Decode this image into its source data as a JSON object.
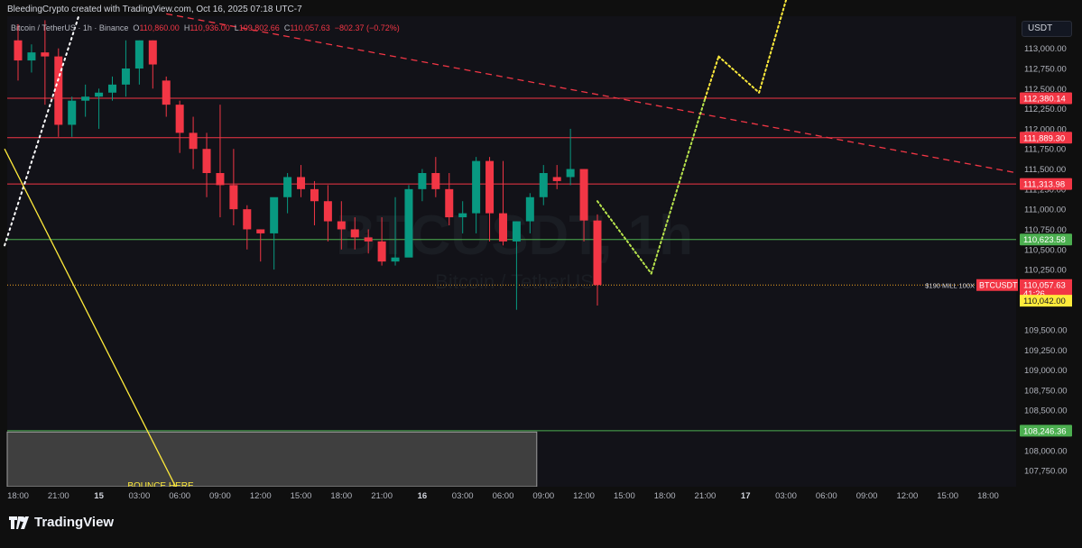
{
  "caption": "BleedingCrypto created with TradingView.com, Oct 16, 2025 07:18 UTC-7",
  "symbol_line": {
    "symbol": "Bitcoin / TetherUS · 1h · Binance",
    "o_label": "O",
    "o": "110,860.00",
    "h_label": "H",
    "h": "110,936.00",
    "l_label": "L",
    "l": "109,802.66",
    "c_label": "C",
    "c": "110,057.63",
    "change": "−802.37 (−0.72%)"
  },
  "currency_button": "USDT",
  "watermark": {
    "ticker": "BTCUSDT, 1h",
    "name": "Bitcoin / TetherUS"
  },
  "brand": "TradingView",
  "colors": {
    "background": "#0f0f0f",
    "up": "#089981",
    "down": "#f23645",
    "resistance_line": "#f23645",
    "support_line": "#4caf50",
    "current_price_line": "#f5a623",
    "target_yellow": "#ffeb3b"
  },
  "chart_data": {
    "type": "candlestick",
    "timeframe": "1h",
    "ylim": [
      107550,
      113400
    ],
    "y_ticks": [
      "113,000.00",
      "112,750.00",
      "112,500.00",
      "112,250.00",
      "112,000.00",
      "111,750.00",
      "111,500.00",
      "111,250.00",
      "111,000.00",
      "110,750.00",
      "110,500.00",
      "110,250.00",
      "109,500.00",
      "109,250.00",
      "109,000.00",
      "108,750.00",
      "108,500.00",
      "108,000.00",
      "107,750.00"
    ],
    "y_tick_values": [
      113000,
      112750,
      112500,
      112250,
      112000,
      111750,
      111500,
      111250,
      111000,
      110750,
      110500,
      110250,
      109500,
      109250,
      109000,
      108750,
      108500,
      108000,
      107750
    ],
    "x_ticks": [
      {
        "label": "18:00",
        "bar": 0
      },
      {
        "label": "21:00",
        "bar": 3
      },
      {
        "label": "15",
        "bar": 6,
        "bold": true
      },
      {
        "label": "03:00",
        "bar": 9
      },
      {
        "label": "06:00",
        "bar": 12
      },
      {
        "label": "09:00",
        "bar": 15
      },
      {
        "label": "12:00",
        "bar": 18
      },
      {
        "label": "15:00",
        "bar": 21
      },
      {
        "label": "18:00",
        "bar": 24
      },
      {
        "label": "21:00",
        "bar": 27
      },
      {
        "label": "16",
        "bar": 30,
        "bold": true
      },
      {
        "label": "03:00",
        "bar": 33
      },
      {
        "label": "06:00",
        "bar": 36
      },
      {
        "label": "09:00",
        "bar": 39
      },
      {
        "label": "12:00",
        "bar": 42
      },
      {
        "label": "15:00",
        "bar": 45
      },
      {
        "label": "18:00",
        "bar": 48
      },
      {
        "label": "21:00",
        "bar": 51
      },
      {
        "label": "17",
        "bar": 54,
        "bold": true
      },
      {
        "label": "03:00",
        "bar": 57
      },
      {
        "label": "06:00",
        "bar": 60
      },
      {
        "label": "09:00",
        "bar": 63
      },
      {
        "label": "12:00",
        "bar": 66
      },
      {
        "label": "15:00",
        "bar": 69
      },
      {
        "label": "18:00",
        "bar": 72
      }
    ],
    "candles": [
      {
        "o": 113100,
        "h": 113300,
        "c": 112850,
        "l": 112600
      },
      {
        "o": 112850,
        "h": 113050,
        "c": 112950,
        "l": 112700
      },
      {
        "o": 112950,
        "h": 113350,
        "c": 112900,
        "l": 112300
      },
      {
        "o": 112900,
        "h": 113000,
        "c": 112050,
        "l": 111900
      },
      {
        "o": 112050,
        "h": 112400,
        "c": 112350,
        "l": 111900
      },
      {
        "o": 112350,
        "h": 112550,
        "c": 112400,
        "l": 112150
      },
      {
        "o": 112400,
        "h": 112500,
        "c": 112450,
        "l": 112000
      },
      {
        "o": 112450,
        "h": 112650,
        "c": 112550,
        "l": 112350
      },
      {
        "o": 112550,
        "h": 113100,
        "c": 112750,
        "l": 112400
      },
      {
        "o": 112750,
        "h": 113100,
        "c": 113100,
        "l": 112550
      },
      {
        "o": 113100,
        "h": 113100,
        "c": 112800,
        "l": 112500
      },
      {
        "o": 112600,
        "h": 112650,
        "c": 112300,
        "l": 112150
      },
      {
        "o": 112300,
        "h": 112350,
        "c": 111950,
        "l": 111700
      },
      {
        "o": 111950,
        "h": 112150,
        "c": 111750,
        "l": 111500
      },
      {
        "o": 111750,
        "h": 111950,
        "c": 111450,
        "l": 111150
      },
      {
        "o": 111450,
        "h": 112300,
        "c": 111300,
        "l": 110900
      },
      {
        "o": 111300,
        "h": 111750,
        "c": 111000,
        "l": 110800
      },
      {
        "o": 111000,
        "h": 111050,
        "c": 110750,
        "l": 110500
      },
      {
        "o": 110750,
        "h": 110750,
        "c": 110700,
        "l": 110350
      },
      {
        "o": 110700,
        "h": 110800,
        "c": 111150,
        "l": 110250
      },
      {
        "o": 111150,
        "h": 111450,
        "c": 111400,
        "l": 110950
      },
      {
        "o": 111400,
        "h": 111550,
        "c": 111250,
        "l": 111150
      },
      {
        "o": 111250,
        "h": 111350,
        "c": 111100,
        "l": 110800
      },
      {
        "o": 111100,
        "h": 111300,
        "c": 110850,
        "l": 110600
      },
      {
        "o": 110850,
        "h": 111100,
        "c": 110750,
        "l": 110500
      },
      {
        "o": 110750,
        "h": 110900,
        "c": 110650,
        "l": 110500
      },
      {
        "o": 110650,
        "h": 110750,
        "c": 110600,
        "l": 110450
      },
      {
        "o": 110600,
        "h": 110900,
        "c": 110350,
        "l": 110300
      },
      {
        "o": 110350,
        "h": 111150,
        "c": 110400,
        "l": 110300
      },
      {
        "o": 110400,
        "h": 111300,
        "c": 111250,
        "l": 111050
      },
      {
        "o": 111250,
        "h": 111500,
        "c": 111450,
        "l": 111100
      },
      {
        "o": 111450,
        "h": 111650,
        "c": 111250,
        "l": 111150
      },
      {
        "o": 111250,
        "h": 111450,
        "c": 110900,
        "l": 110800
      },
      {
        "o": 110900,
        "h": 111100,
        "c": 110950,
        "l": 110700
      },
      {
        "o": 110950,
        "h": 111650,
        "c": 111600,
        "l": 110700
      },
      {
        "o": 111600,
        "h": 111650,
        "c": 110950,
        "l": 110600
      },
      {
        "o": 110950,
        "h": 111600,
        "c": 110600,
        "l": 110550
      },
      {
        "o": 110600,
        "h": 110850,
        "c": 110850,
        "l": 109750
      },
      {
        "o": 110850,
        "h": 111200,
        "c": 111150,
        "l": 110700
      },
      {
        "o": 111150,
        "h": 111550,
        "c": 111450,
        "l": 111050
      },
      {
        "o": 111400,
        "h": 111550,
        "c": 111350,
        "l": 111250
      },
      {
        "o": 111400,
        "h": 112000,
        "c": 111500,
        "l": 111300
      },
      {
        "o": 111500,
        "h": 111500,
        "c": 110860,
        "l": 110600
      },
      {
        "o": 110860,
        "h": 110936,
        "c": 110057.63,
        "l": 109802.66
      }
    ],
    "horizontal_lines": [
      {
        "price": 112380.14,
        "label": "112,380.14",
        "color": "#f23645"
      },
      {
        "price": 111889.3,
        "label": "111,889.30",
        "color": "#f23645"
      },
      {
        "price": 111313.98,
        "label": "111,313.98",
        "color": "#f23645"
      },
      {
        "price": 110623.58,
        "label": "110,623.58",
        "color": "#4caf50"
      },
      {
        "price": 108246.36,
        "label": "108,246.36",
        "color": "#4caf50"
      }
    ],
    "current_price": {
      "price": 110057.63,
      "label": "110,057.63",
      "countdown": "41:26",
      "symbol": "BTCUSDT",
      "note": "$190 MILL 100X"
    },
    "secondary_price": {
      "price": 110042.0,
      "label": "110,042.00"
    },
    "descending_trendline": {
      "from": {
        "bar": 11,
        "price": 113430
      },
      "to": {
        "bar": 86,
        "price": 111080
      }
    },
    "white_trendline": {
      "from": {
        "bar": -1,
        "price": 110550
      },
      "to": {
        "bar": 4.5,
        "price": 113400
      }
    },
    "yellow_line": {
      "from": {
        "bar": -1,
        "price": 111750
      },
      "to": {
        "bar": 11.7,
        "price": 107550
      }
    },
    "projection_path": [
      {
        "bar": 43,
        "price": 111100
      },
      {
        "bar": 47,
        "price": 110200
      },
      {
        "bar": 51,
        "price": 112380
      },
      {
        "bar": 52,
        "price": 112900
      },
      {
        "bar": 55,
        "price": 112450
      },
      {
        "bar": 57,
        "price": 113600
      }
    ],
    "zone": {
      "from_bar": -1,
      "to_bar": 38.5,
      "top": 108230,
      "bottom": 107550,
      "label": "BOUNCE HERE"
    }
  }
}
